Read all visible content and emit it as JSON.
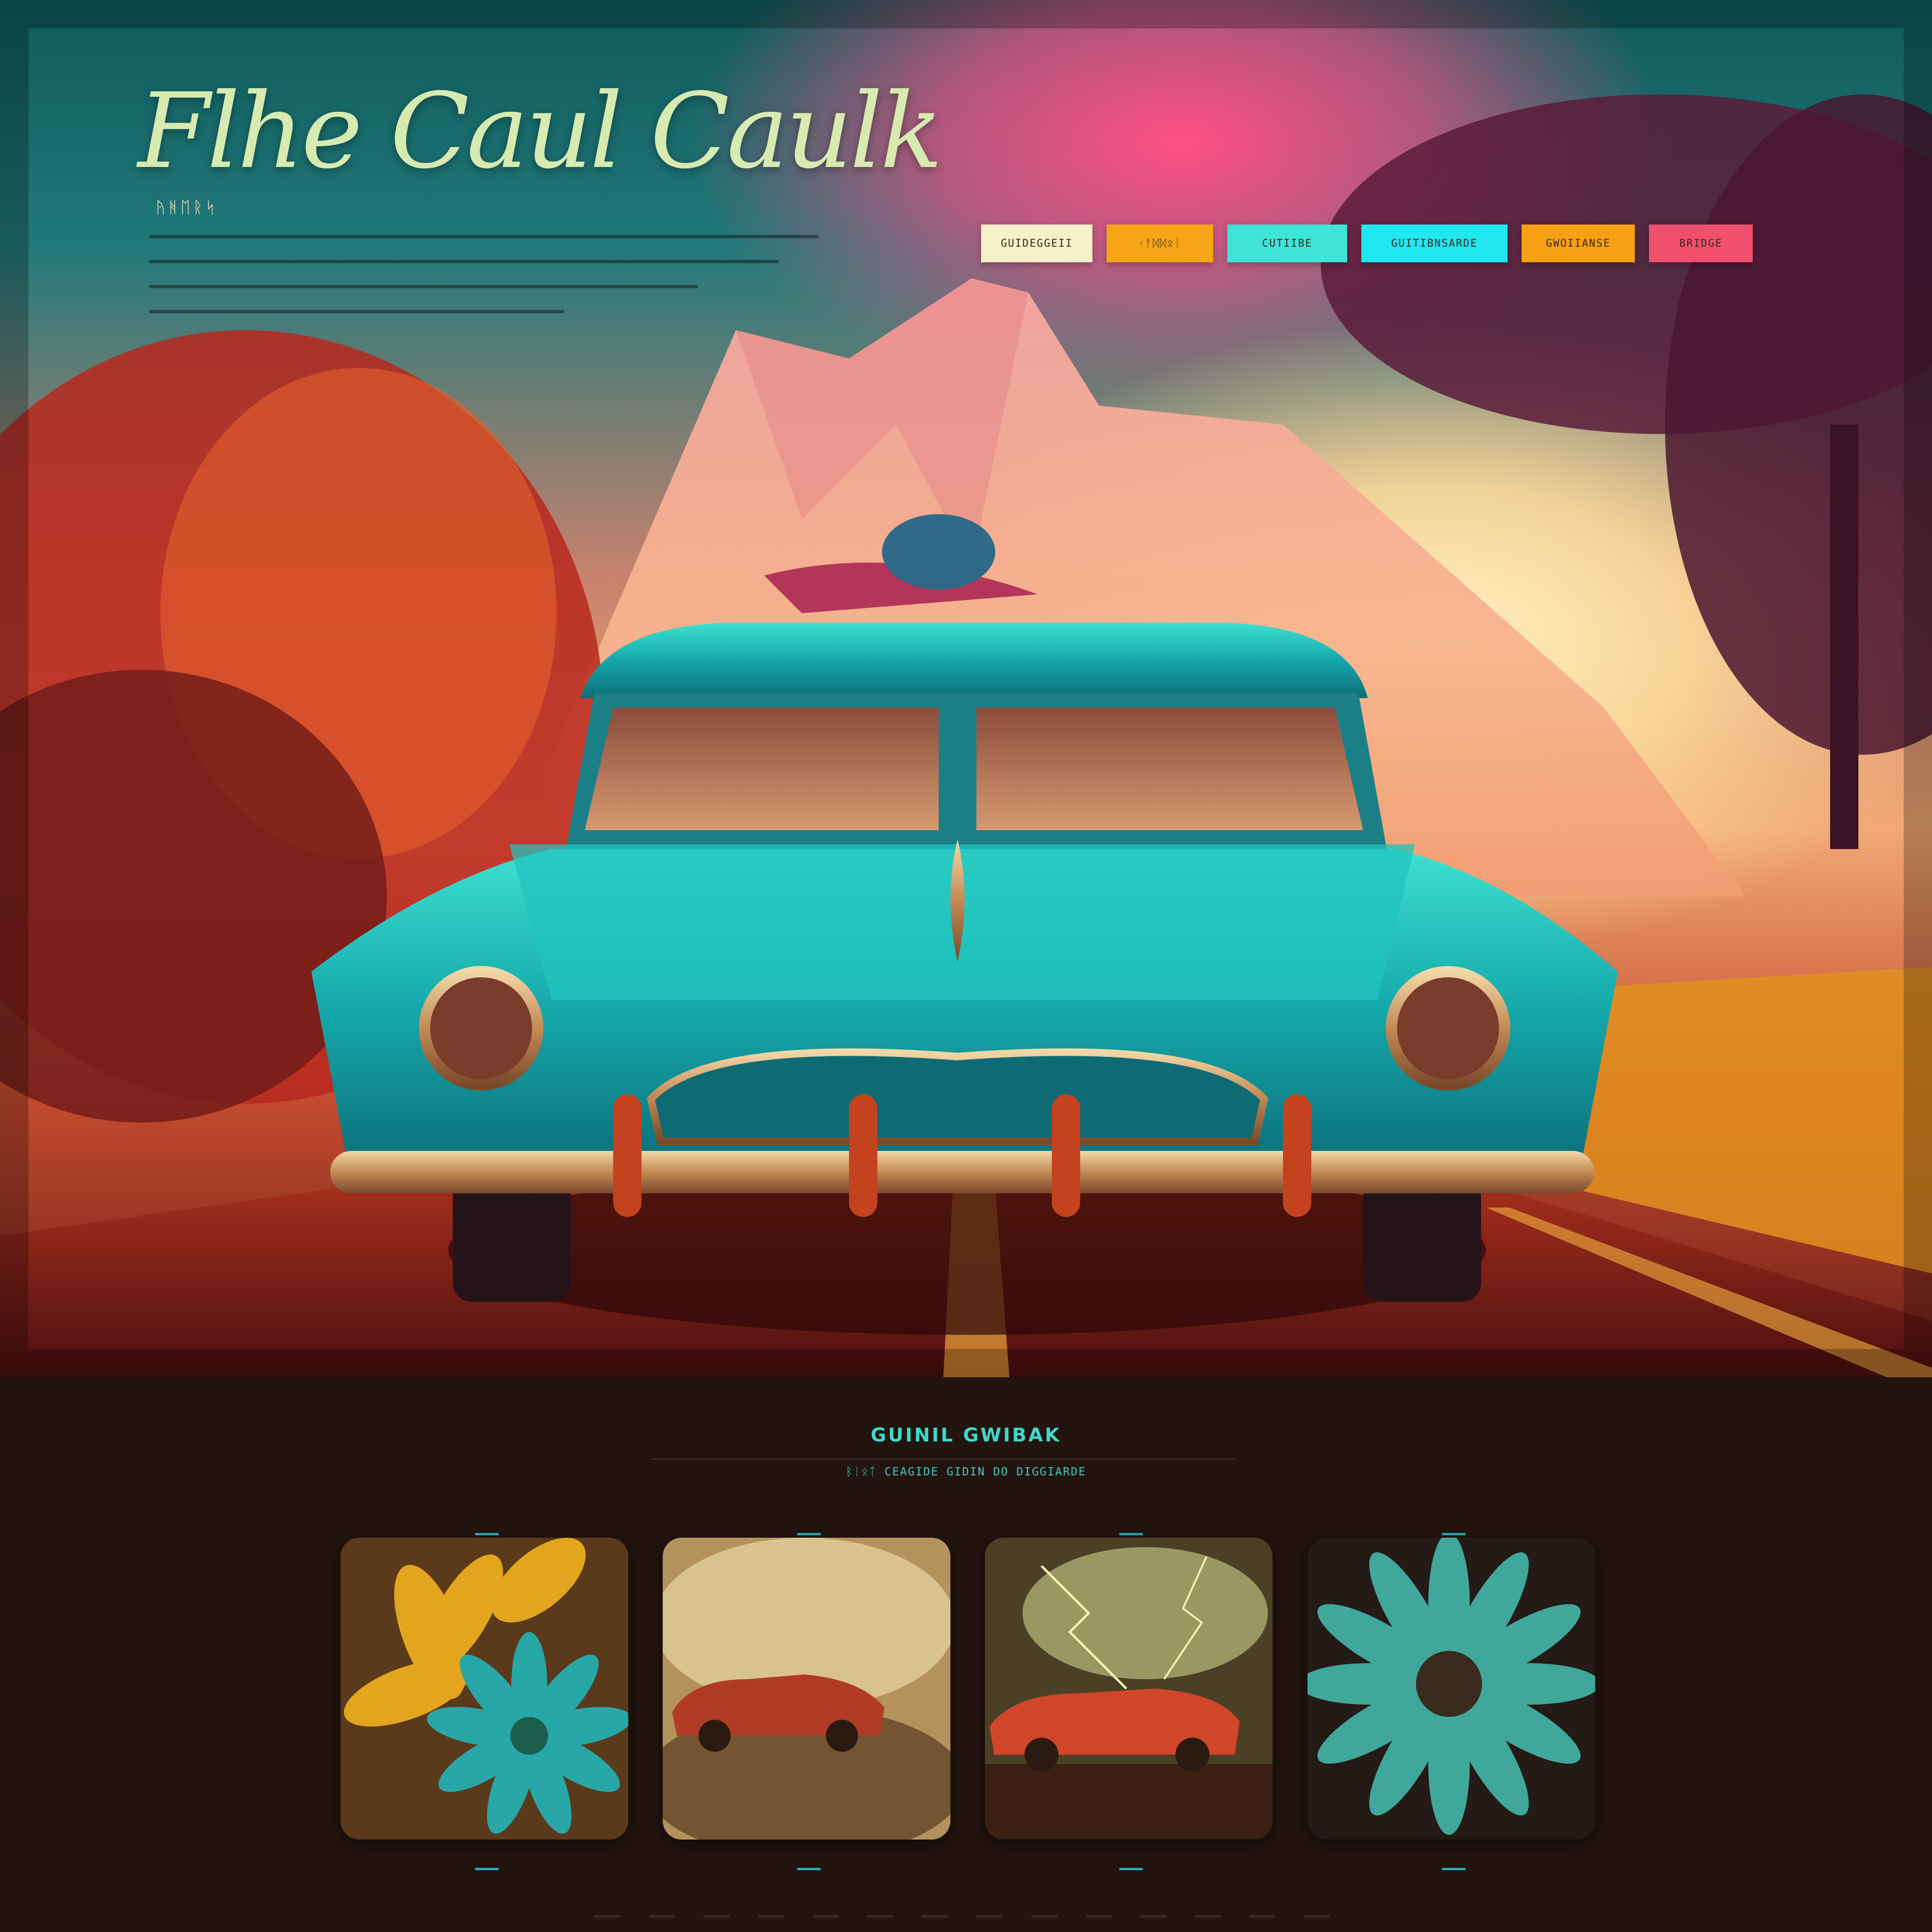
{
  "site": {
    "title": "Flhe Caul Caulk",
    "eyebrow": "ᚤᚻᛖᚱᛋ",
    "intro_lines": 4
  },
  "nav": {
    "items": [
      {
        "label": "GUIDEGGEII",
        "color": "#f4f0c8"
      },
      {
        "label": "ᚲᚨᛞᛞᛟᛁ",
        "color": "#f5a516"
      },
      {
        "label": "CUTIIBE",
        "color": "#3fe3d7"
      },
      {
        "label": "GUITIBNSARDE",
        "color": "#22e6f0"
      },
      {
        "label": "GWOIIANSE",
        "color": "#f6a014"
      },
      {
        "label": "BRIDGE",
        "color": "#f0506e"
      }
    ]
  },
  "section": {
    "title": "GUINIL GWIBAK",
    "subtitle": "ᛒᛁᛟᛏ CEAGIDE GIDIN DO DIGGIARDE"
  },
  "gallery": {
    "items": [
      {
        "name": "yellow-teal-flowers",
        "subject": "flowers"
      },
      {
        "name": "red-car-sepia-storm",
        "subject": "car"
      },
      {
        "name": "red-car-lightning",
        "subject": "car"
      },
      {
        "name": "teal-daisy",
        "subject": "flower"
      }
    ]
  },
  "colors": {
    "accent_teal": "#3fd8c9",
    "title_cream": "#d7eab0",
    "car_teal": "#1fb9b6",
    "background_dark": "#22140f"
  }
}
